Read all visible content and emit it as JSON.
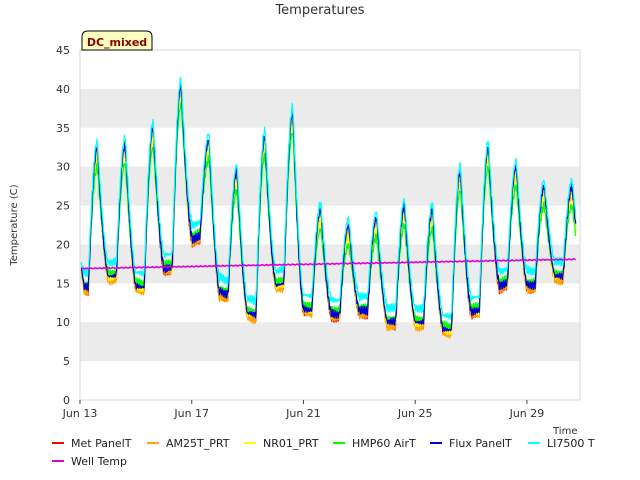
{
  "chart_data": {
    "type": "line",
    "title": "Temperatures",
    "ylabel": "Temperature (C)",
    "xlabel": "Time",
    "ylim": [
      0,
      45
    ],
    "yticks": [
      0,
      5,
      10,
      15,
      20,
      25,
      30,
      35,
      40,
      45
    ],
    "xlim_days": [
      13,
      30.9
    ],
    "xticks": [
      {
        "day": 13,
        "label": "Jun 13"
      },
      {
        "day": 17,
        "label": "Jun 17"
      },
      {
        "day": 21,
        "label": "Jun 21"
      },
      {
        "day": 25,
        "label": "Jun 25"
      },
      {
        "day": 29,
        "label": "Jun 29"
      }
    ],
    "grid": "horizontal bands",
    "badge": "DC_mixed",
    "legend_position": "bottom",
    "colors": {
      "band": "#ebebeb",
      "badge_bg": "#ffffc0",
      "badge_text": "#8b0000"
    },
    "daily_extremes": {
      "day": [
        13,
        14,
        15,
        16,
        17,
        18,
        19,
        20,
        21,
        22,
        23,
        24,
        25,
        26,
        27,
        28,
        29,
        30
      ],
      "min": [
        14.5,
        16.0,
        14.5,
        17.0,
        21.0,
        13.5,
        11.0,
        15.0,
        11.5,
        11.0,
        11.5,
        10.0,
        10.0,
        9.0,
        11.5,
        15.0,
        14.8,
        16.0
      ],
      "max": [
        32.5,
        33.0,
        35.0,
        40.5,
        33.5,
        29.5,
        34.0,
        37.0,
        24.5,
        22.5,
        23.5,
        25.0,
        24.5,
        29.5,
        32.5,
        30.0,
        27.5,
        27.5
      ]
    },
    "series": [
      {
        "name": "Met PanelT",
        "color": "#ff0000",
        "offset": -0.3,
        "min_offset": -0.5
      },
      {
        "name": "AM25T_PRT",
        "color": "#ffa500",
        "offset": -0.5,
        "min_offset": -0.6
      },
      {
        "name": "NR01_PRT",
        "color": "#ffff00",
        "offset": -1.5,
        "min_offset": 0.0
      },
      {
        "name": "HMP60 AirT",
        "color": "#00ff00",
        "offset": -2.5,
        "min_offset": 0.5
      },
      {
        "name": "Flux PanelT",
        "color": "#0000cd",
        "offset": 0.0,
        "min_offset": 0.0
      },
      {
        "name": "LI7500 T",
        "color": "#00ffff",
        "offset": 0.8,
        "min_offset": 1.8
      },
      {
        "name": "Well Temp",
        "color": "#dd00dd",
        "start": 16.9,
        "end": 18.1
      }
    ]
  }
}
